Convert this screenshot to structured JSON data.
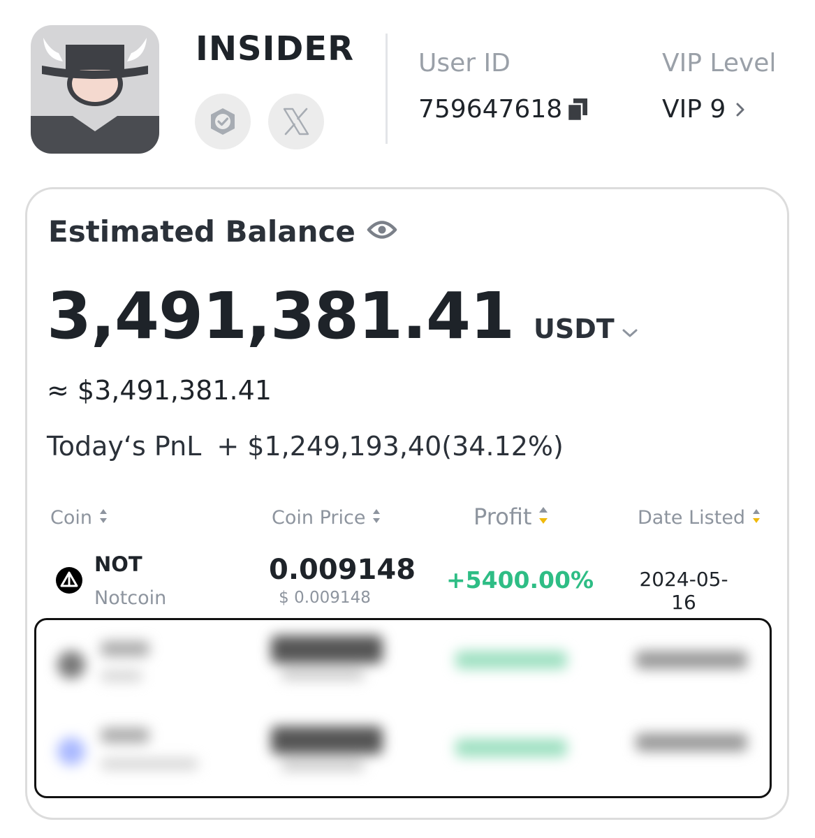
{
  "profile": {
    "username": "INSIDER",
    "user_id_label": "User ID",
    "user_id": "759647618",
    "vip_label": "VIP Level",
    "vip_value": "VIP 9"
  },
  "balance": {
    "title": "Estimated Balance",
    "amount": "3,491,381.41",
    "currency": "USDT",
    "approx": "≈ $3,491,381.41",
    "pnl_label": "Today‘s PnL",
    "pnl_value": "+ $1,249,193,40(34.12%)"
  },
  "table": {
    "headers": {
      "coin": "Coin",
      "price": "Coin Price",
      "profit": "Profit",
      "date": "Date Listed"
    },
    "rows": [
      {
        "symbol": "NOT",
        "name": "Notcoin",
        "price": "0.009148",
        "price_usd": "$ 0.009148",
        "profit": "+5400.00%",
        "date": "2024-05-16"
      }
    ]
  },
  "colors": {
    "profit_green": "#2ebd85",
    "accent_yellow": "#f0b90b",
    "muted_gray": "#8d949e"
  },
  "icons": [
    "verified-badge-icon",
    "x-logo-icon",
    "copy-icon",
    "chevron-right-icon",
    "eye-icon",
    "chevron-down-icon",
    "sort-icon",
    "notcoin-logo-icon"
  ]
}
